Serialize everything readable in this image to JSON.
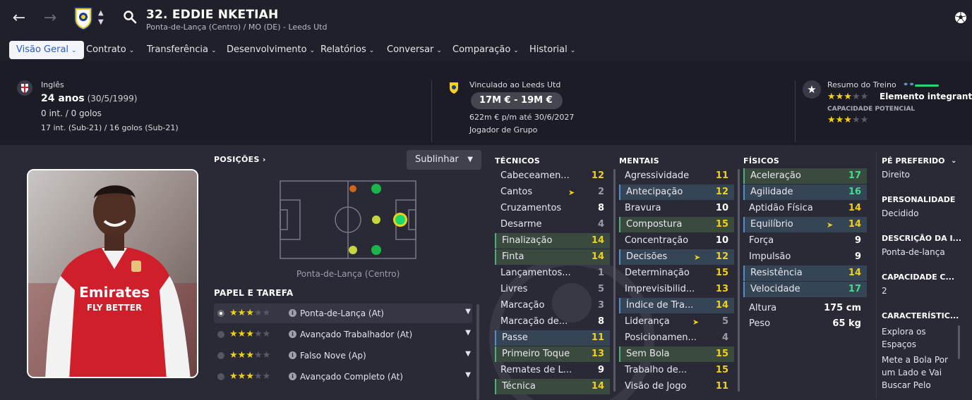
{
  "header": {
    "back_icon": "arrow-left-icon",
    "forward_icon": "arrow-right-icon",
    "club_crest": "leeds-crest",
    "title": "32. EDDIE NKETIAH",
    "subtitle": "Ponta-de-Lança (Centro) / MO (DE) - Leeds Utd"
  },
  "tabs": [
    {
      "label": "Visão Geral",
      "active": true
    },
    {
      "label": "Contrato"
    },
    {
      "label": "Transferência"
    },
    {
      "label": "Desenvolvimento"
    },
    {
      "label": "Relatórios"
    },
    {
      "label": "Conversar"
    },
    {
      "label": "Comparação"
    },
    {
      "label": "Historial"
    }
  ],
  "info": {
    "nationality": "Inglês",
    "age": "24 anos",
    "dob": "(30/5/1999)",
    "intl": "0 int. / 0 golos",
    "u21": "17 int. (Sub-21) / 16 golos (Sub-21)",
    "contract_club": "Vinculado ao Leeds Utd",
    "value": "17M € - 19M €",
    "wage": "622m € p/m até 30/6/2027",
    "squad_status": "Jogador de Grupo",
    "training_label": "Resumo do Treino",
    "current_ability_stars": 3,
    "role_label": "Elemento integrante",
    "potential_label": "CAPACIDADE POTENCIAL",
    "potential_stars": 3
  },
  "positions": {
    "title": "POSIÇÕES",
    "highlight_button": "Sublinhar",
    "caption": "Ponta-de-Lança (Centro)"
  },
  "roles": {
    "title": "PAPEL E TAREFA",
    "items": [
      {
        "name": "Ponta-de-Lança (At)",
        "stars": 3,
        "selected": true
      },
      {
        "name": "Avançado Trabalhador (At)",
        "stars": 3
      },
      {
        "name": "Falso Nove (Ap)",
        "stars": 3
      },
      {
        "name": "Avançado Completo (At)",
        "stars": 3
      }
    ]
  },
  "technical": {
    "title": "TÉCNICOS",
    "items": [
      {
        "name": "Cabeceamen...",
        "value": "12",
        "hl": "",
        "color": "#f0d11a"
      },
      {
        "name": "Cantos",
        "value": "2",
        "hl": "",
        "flag": true,
        "color": "#9a9aa8"
      },
      {
        "name": "Cruzamentos",
        "value": "8",
        "hl": "",
        "color": "#ffffff"
      },
      {
        "name": "Desarme",
        "value": "4",
        "hl": "",
        "color": "#9a9aa8"
      },
      {
        "name": "Finalização",
        "value": "14",
        "hl": "green",
        "color": "#f0d11a"
      },
      {
        "name": "Finta",
        "value": "14",
        "hl": "green",
        "color": "#f0d11a"
      },
      {
        "name": "Lançamentos...",
        "value": "1",
        "hl": "",
        "color": "#9a9aa8"
      },
      {
        "name": "Livres",
        "value": "5",
        "hl": "",
        "color": "#9a9aa8"
      },
      {
        "name": "Marcação",
        "value": "3",
        "hl": "",
        "color": "#9a9aa8"
      },
      {
        "name": "Marcação de...",
        "value": "8",
        "hl": "",
        "color": "#ffffff"
      },
      {
        "name": "Passe",
        "value": "11",
        "hl": "blue",
        "color": "#f0d11a"
      },
      {
        "name": "Primeiro Toque",
        "value": "13",
        "hl": "green",
        "color": "#f0d11a"
      },
      {
        "name": "Remates de L...",
        "value": "9",
        "hl": "",
        "color": "#ffffff"
      },
      {
        "name": "Técnica",
        "value": "14",
        "hl": "green",
        "color": "#f0d11a"
      }
    ]
  },
  "mental": {
    "title": "MENTAIS",
    "items": [
      {
        "name": "Agressividade",
        "value": "11",
        "hl": "",
        "color": "#f0d11a"
      },
      {
        "name": "Antecipação",
        "value": "12",
        "hl": "blue",
        "color": "#f0d11a"
      },
      {
        "name": "Bravura",
        "value": "10",
        "hl": "",
        "color": "#ffffff"
      },
      {
        "name": "Compostura",
        "value": "15",
        "hl": "green",
        "color": "#f0d11a"
      },
      {
        "name": "Concentração",
        "value": "10",
        "hl": "",
        "color": "#ffffff"
      },
      {
        "name": "Decisões",
        "value": "12",
        "hl": "blue",
        "flag": true,
        "color": "#f0d11a"
      },
      {
        "name": "Determinação",
        "value": "15",
        "hl": "",
        "color": "#f0d11a"
      },
      {
        "name": "Imprevisibilid...",
        "value": "13",
        "hl": "",
        "color": "#f0d11a"
      },
      {
        "name": "Índice de Tra...",
        "value": "14",
        "hl": "blue",
        "color": "#f0d11a"
      },
      {
        "name": "Liderança",
        "value": "5",
        "hl": "",
        "flag": true,
        "color": "#9a9aa8"
      },
      {
        "name": "Posicionamen...",
        "value": "4",
        "hl": "",
        "color": "#9a9aa8"
      },
      {
        "name": "Sem Bola",
        "value": "15",
        "hl": "green",
        "color": "#f0d11a"
      },
      {
        "name": "Trabalho de...",
        "value": "15",
        "hl": "",
        "color": "#f0d11a"
      },
      {
        "name": "Visão de Jogo",
        "value": "11",
        "hl": "",
        "color": "#f0d11a"
      }
    ]
  },
  "physical": {
    "title": "FÍSICOS",
    "items": [
      {
        "name": "Aceleração",
        "value": "17",
        "hl": "green",
        "color": "#3fe08a"
      },
      {
        "name": "Agilidade",
        "value": "16",
        "hl": "blue",
        "color": "#3fe08a"
      },
      {
        "name": "Aptidão Física",
        "value": "14",
        "hl": "",
        "color": "#f0d11a"
      },
      {
        "name": "Equilíbrio",
        "value": "14",
        "hl": "blue",
        "flag": true,
        "color": "#f0d11a"
      },
      {
        "name": "Força",
        "value": "9",
        "hl": "",
        "color": "#ffffff"
      },
      {
        "name": "Impulsão",
        "value": "9",
        "hl": "",
        "color": "#ffffff"
      },
      {
        "name": "Resistência",
        "value": "14",
        "hl": "blue",
        "color": "#f0d11a"
      },
      {
        "name": "Velocidade",
        "value": "17",
        "hl": "blue",
        "color": "#3fe08a"
      }
    ],
    "height_label": "Altura",
    "height": "175 cm",
    "weight_label": "Peso",
    "weight": "65 kg"
  },
  "side": {
    "foot_title": "PÉ PREFERIDO",
    "foot": "Direito",
    "personality_title": "PERSONALIDADE",
    "personality": "Decidido",
    "desc_title": "DESCRIÇÃO DA I...",
    "desc": "Ponta-de-lança",
    "ability_title": "CAPACIDADE C...",
    "ability": "2",
    "traits_title": "CARACTERÍSTIC...",
    "trait1_line1": "Explora os",
    "trait1_line2": "Espaços",
    "trait2_line1": "Mete a Bola Por",
    "trait2_line2": "um Lado e Vai",
    "trait2_line3": "Buscar Pelo"
  },
  "photo": {
    "shirt_sponsor": "Emirates",
    "shirt_sponsor_line2": "FLY BETTER"
  }
}
